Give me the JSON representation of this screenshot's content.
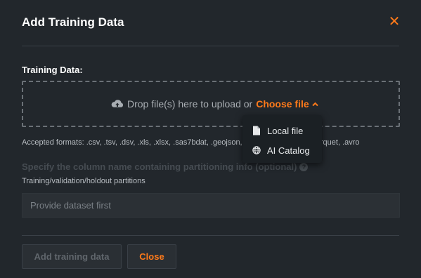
{
  "dialog": {
    "title": "Add Training Data",
    "close_icon": "close-icon"
  },
  "training_data": {
    "label": "Training Data:",
    "drop_text": "Drop file(s) here to upload or",
    "choose_file": "Choose file",
    "accepted_formats": "Accepted formats: .csv, .tsv, .dsv, .xls, .xlsx, .sas7bdat, .geojson, .gz, .bz2, .tar, .tgz, .parquet, .avro"
  },
  "partition": {
    "label": "Specify the column name containing partitioning info (optional)",
    "sublabel": "Training/validation/holdout partitions",
    "placeholder": "Provide dataset first"
  },
  "buttons": {
    "add": "Add training data",
    "close": "Close"
  },
  "menu": {
    "items": [
      {
        "label": "Local file",
        "icon": "file-icon"
      },
      {
        "label": "AI Catalog",
        "icon": "globe-icon"
      }
    ]
  },
  "colors": {
    "accent": "#ff7a1a",
    "background": "#22272c"
  }
}
